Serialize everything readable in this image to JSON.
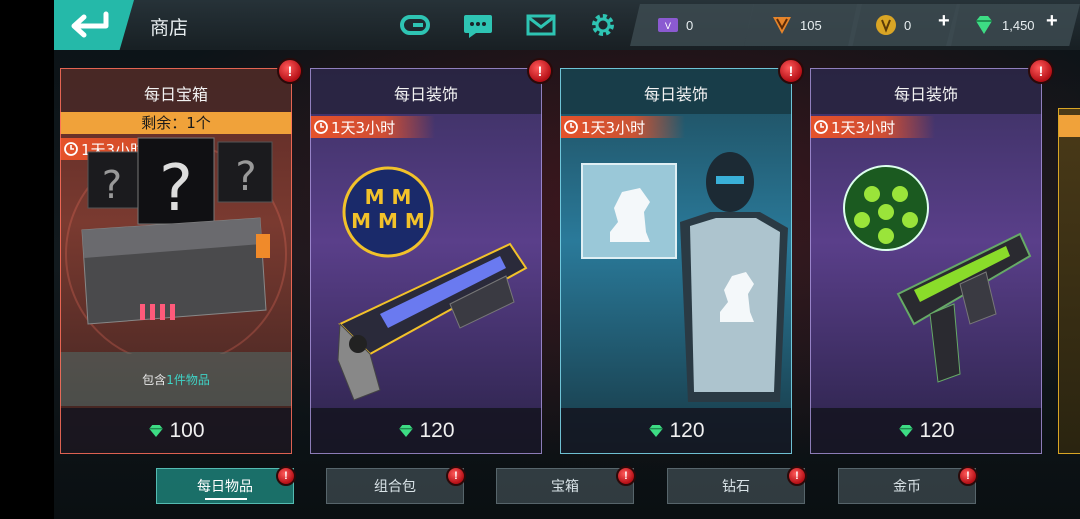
{
  "header": {
    "title": "商店",
    "icons": [
      "back-arrow-icon",
      "gameloft-logo-icon",
      "chat-icon",
      "mail-icon",
      "settings-gear-icon"
    ]
  },
  "currencies": [
    {
      "name": "vip-points",
      "value": "0",
      "color": "#8b5ad1"
    },
    {
      "name": "tokens",
      "value": "105",
      "color": "#e6842a"
    },
    {
      "name": "gold",
      "value": "0",
      "color": "#d9a525",
      "plus": "+"
    },
    {
      "name": "diamonds",
      "value": "1,450",
      "color": "#3ddc84",
      "plus": "+"
    }
  ],
  "cards": [
    {
      "title": "每日宝箱",
      "remaining": "剩余：1个",
      "timer": "1天3小时",
      "contains_prefix": "包含",
      "contains_link": "1件物品",
      "price": "100",
      "alert": "!"
    },
    {
      "title": "每日装饰",
      "timer": "1天3小时",
      "price": "120",
      "alert": "!"
    },
    {
      "title": "每日装饰",
      "timer": "1天3小时",
      "price": "120",
      "alert": "!"
    },
    {
      "title": "每日装饰",
      "timer": "1天3小时",
      "price": "120",
      "alert": "!"
    }
  ],
  "tabs": [
    {
      "label": "每日物品",
      "active": true,
      "alert": "!"
    },
    {
      "label": "组合包",
      "active": false,
      "alert": "!"
    },
    {
      "label": "宝箱",
      "active": false,
      "alert": "!"
    },
    {
      "label": "钻石",
      "active": false,
      "alert": "!"
    },
    {
      "label": "金币",
      "active": false,
      "alert": "!"
    }
  ],
  "colors": {
    "accent": "#25b9a9",
    "alert": "#d3161f",
    "timer": "#e6522a",
    "remaining": "#f0a23a"
  }
}
